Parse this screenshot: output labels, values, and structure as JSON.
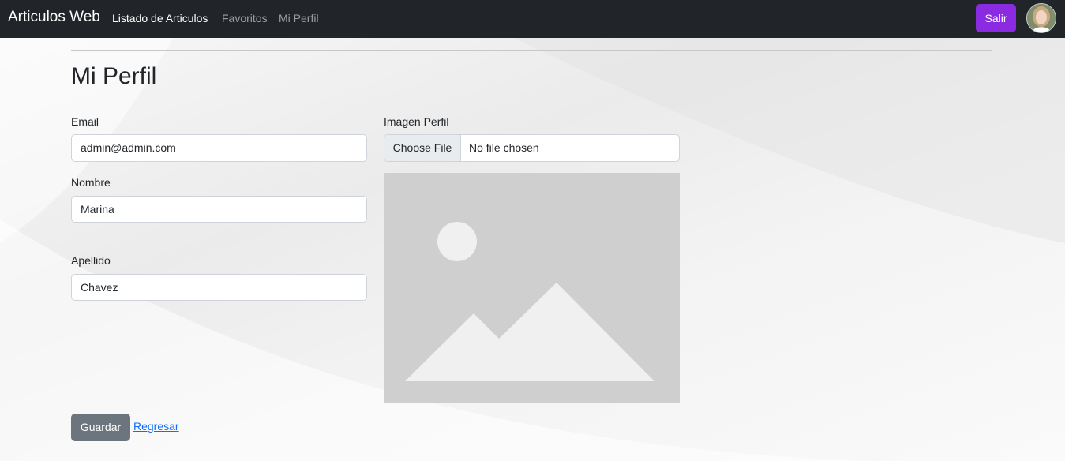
{
  "navbar": {
    "brand": "Articulos Web",
    "links": [
      {
        "label": "Listado de Articulos",
        "active": true
      },
      {
        "label": "Favoritos",
        "active": false
      },
      {
        "label": "Mi Perfil",
        "active": false
      }
    ],
    "logout_label": "Salir",
    "accent_color": "#8a2be2"
  },
  "page": {
    "title": "Mi Perfil"
  },
  "form": {
    "email_label": "Email",
    "email_value": "admin@admin.com",
    "nombre_label": "Nombre",
    "nombre_value": "Marina",
    "apellido_label": "Apellido",
    "apellido_value": "Chavez",
    "imagen_label": "Imagen Perfil",
    "file_button_label": "Choose File",
    "file_status": "No file chosen",
    "image_icon": "image-placeholder-icon"
  },
  "actions": {
    "save_label": "Guardar",
    "back_label": "Regresar"
  }
}
